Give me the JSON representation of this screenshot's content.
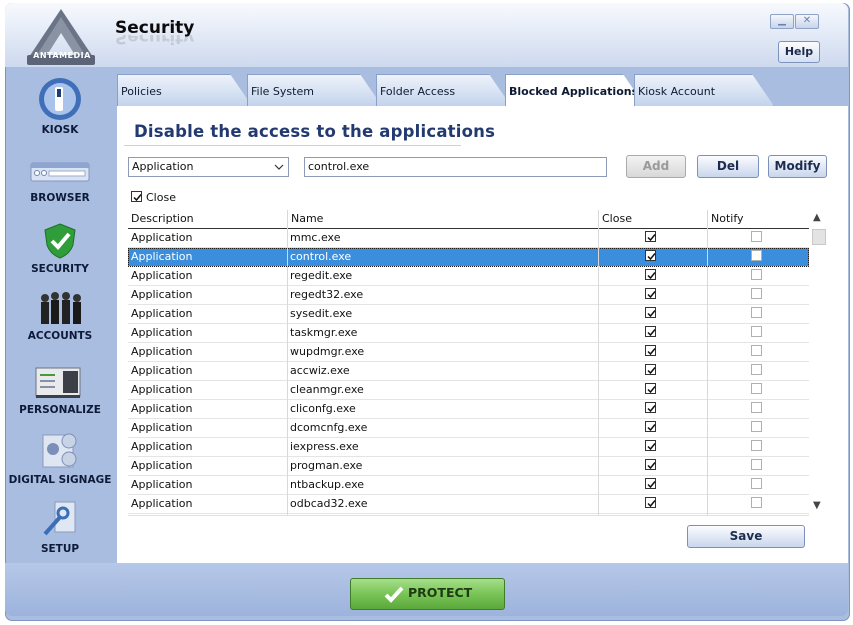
{
  "app": {
    "title": "Security",
    "logo_text": "ANTAMEDIA",
    "help_label": "Help",
    "window_buttons": [
      "minimize-icon",
      "close-icon"
    ]
  },
  "sidebar": {
    "items": [
      {
        "label": "KIOSK",
        "icon": "kiosk-icon"
      },
      {
        "label": "BROWSER",
        "icon": "browser-icon"
      },
      {
        "label": "SECURITY",
        "icon": "shield-check-icon"
      },
      {
        "label": "ACCOUNTS",
        "icon": "people-icon"
      },
      {
        "label": "PERSONALIZE",
        "icon": "desktop-icon"
      },
      {
        "label": "DIGITAL SIGNAGE",
        "icon": "signage-icon"
      },
      {
        "label": "SETUP",
        "icon": "setup-icon"
      }
    ]
  },
  "tabs": [
    {
      "label": "Policies",
      "active": false
    },
    {
      "label": "File System",
      "active": false
    },
    {
      "label": "Folder Access",
      "active": false
    },
    {
      "label": "Blocked Applications",
      "active": true
    },
    {
      "label": "Kiosk Account",
      "active": false
    }
  ],
  "main": {
    "heading": "Disable the access to the applications",
    "type_select": "Application",
    "app_input": "control.exe",
    "add_label": "Add",
    "del_label": "Del",
    "modify_label": "Modify",
    "close_checkbox_label": "Close",
    "close_checked": true,
    "save_label": "Save"
  },
  "table": {
    "columns": [
      "Description",
      "Name",
      "Close",
      "Notify"
    ],
    "selected_row": 1,
    "rows": [
      {
        "description": "Application",
        "name": "mmc.exe",
        "close": true,
        "notify": false
      },
      {
        "description": "Application",
        "name": "control.exe",
        "close": true,
        "notify": false
      },
      {
        "description": "Application",
        "name": "regedit.exe",
        "close": true,
        "notify": false
      },
      {
        "description": "Application",
        "name": "regedt32.exe",
        "close": true,
        "notify": false
      },
      {
        "description": "Application",
        "name": "sysedit.exe",
        "close": true,
        "notify": false
      },
      {
        "description": "Application",
        "name": "taskmgr.exe",
        "close": true,
        "notify": false
      },
      {
        "description": "Application",
        "name": "wupdmgr.exe",
        "close": true,
        "notify": false
      },
      {
        "description": "Application",
        "name": "accwiz.exe",
        "close": true,
        "notify": false
      },
      {
        "description": "Application",
        "name": "cleanmgr.exe",
        "close": true,
        "notify": false
      },
      {
        "description": "Application",
        "name": "cliconfg.exe",
        "close": true,
        "notify": false
      },
      {
        "description": "Application",
        "name": "dcomcnfg.exe",
        "close": true,
        "notify": false
      },
      {
        "description": "Application",
        "name": "iexpress.exe",
        "close": true,
        "notify": false
      },
      {
        "description": "Application",
        "name": "progman.exe",
        "close": true,
        "notify": false
      },
      {
        "description": "Application",
        "name": "ntbackup.exe",
        "close": true,
        "notify": false
      },
      {
        "description": "Application",
        "name": "odbcad32.exe",
        "close": true,
        "notify": false
      }
    ]
  },
  "footer": {
    "protect_label": "PROTECT"
  },
  "colors": {
    "accent": "#3b8edb",
    "heading": "#223a6f",
    "frame": "#a9bde0",
    "protect": "#79c457"
  }
}
